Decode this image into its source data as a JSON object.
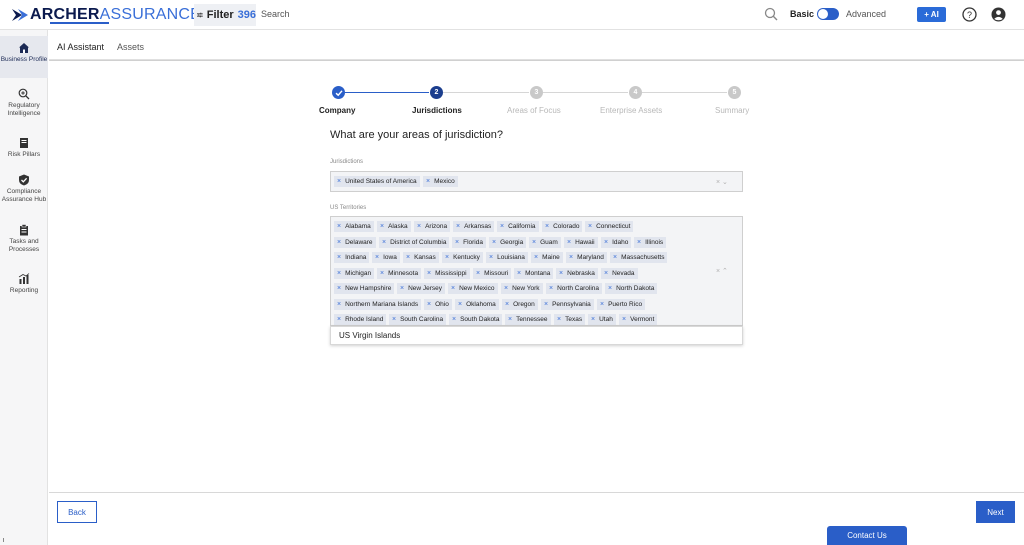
{
  "app": {
    "logo_primary": "ARCHER",
    "logo_secondary": "ASSURANCE AI"
  },
  "header": {
    "filter_label": "Filter",
    "filter_count": "396",
    "search_placeholder": "Search",
    "mode_basic": "Basic",
    "mode_advanced": "Advanced",
    "ai_button": "+ AI",
    "accent_color": "#2a5ec8"
  },
  "sidebar": {
    "items": [
      {
        "label": "Business Profile",
        "icon": "home-icon"
      },
      {
        "label": "Regulatory Intelligence",
        "icon": "search-plus-icon"
      },
      {
        "label": "Risk Pillars",
        "icon": "document-icon"
      },
      {
        "label": "Compliance Assurance Hub",
        "icon": "shield-check-icon"
      },
      {
        "label": "Tasks and Processes",
        "icon": "clipboard-icon"
      },
      {
        "label": "Reporting",
        "icon": "chart-icon"
      }
    ]
  },
  "tabs": [
    {
      "label": "AI Assistant",
      "active": true
    },
    {
      "label": "Assets",
      "active": false
    }
  ],
  "stepper": {
    "steps": [
      {
        "number": "",
        "label": "Company",
        "state": "done"
      },
      {
        "number": "2",
        "label": "Jurisdictions",
        "state": "active"
      },
      {
        "number": "3",
        "label": "Areas of Focus",
        "state": "pending"
      },
      {
        "number": "4",
        "label": "Enterprise Assets",
        "state": "pending"
      },
      {
        "number": "5",
        "label": "Summary",
        "state": "pending"
      }
    ]
  },
  "form": {
    "question": "What are your areas of jurisdiction?",
    "jurisdictions_label": "Jurisdictions",
    "jurisdictions": [
      "United States of America",
      "Mexico"
    ],
    "territories_label": "US Territories",
    "territories": [
      [
        "Alabama",
        "Alaska",
        "Arizona",
        "Arkansas",
        "California",
        "Colorado",
        "Connecticut"
      ],
      [
        "Delaware",
        "District of Columbia",
        "Florida",
        "Georgia",
        "Guam",
        "Hawaii",
        "Idaho",
        "Illinois"
      ],
      [
        "Indiana",
        "Iowa",
        "Kansas",
        "Kentucky",
        "Louisiana",
        "Maine",
        "Maryland",
        "Massachusetts"
      ],
      [
        "Michigan",
        "Minnesota",
        "Mississippi",
        "Missouri",
        "Montana",
        "Nebraska",
        "Nevada"
      ],
      [
        "New Hampshire",
        "New Jersey",
        "New Mexico",
        "New York",
        "North Carolina",
        "North Dakota"
      ],
      [
        "Northern Mariana Islands",
        "Ohio",
        "Oklahoma",
        "Oregon",
        "Pennsylvania",
        "Puerto Rico"
      ],
      [
        "Rhode Island",
        "South Carolina",
        "South Dakota",
        "Tennessee",
        "Texas",
        "Utah",
        "Vermont"
      ]
    ],
    "dropdown_option": "US Virgin Islands"
  },
  "footer": {
    "back_label": "Back",
    "next_label": "Next",
    "contact_label": "Contact Us"
  }
}
